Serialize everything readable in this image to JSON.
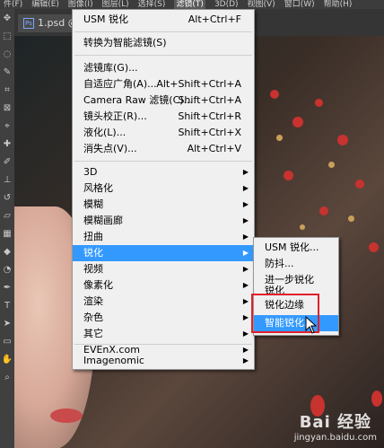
{
  "menubar": {
    "items": [
      "件(F)",
      "编辑(E)",
      "图像(I)",
      "图层(L)",
      "选择(S)",
      "滤镜(T)",
      "3D(D)",
      "视图(V)",
      "窗口(W)",
      "帮助(H)"
    ],
    "active": "滤镜(T)"
  },
  "tab": {
    "label": "1.psd @"
  },
  "filter_menu": {
    "last_filter": {
      "label": "USM 锐化",
      "shortcut": "Alt+Ctrl+F"
    },
    "convert_smart": {
      "label": "转换为智能滤镜(S)"
    },
    "group2": [
      {
        "label": "滤镜库(G)...",
        "shortcut": ""
      },
      {
        "label": "自适应广角(A)...",
        "shortcut": "Alt+Shift+Ctrl+A"
      },
      {
        "label": "Camera Raw 滤镜(C)...",
        "shortcut": "Shift+Ctrl+A"
      },
      {
        "label": "镜头校正(R)...",
        "shortcut": "Shift+Ctrl+R"
      },
      {
        "label": "液化(L)...",
        "shortcut": "Shift+Ctrl+X"
      },
      {
        "label": "消失点(V)...",
        "shortcut": "Alt+Ctrl+V"
      }
    ],
    "group3": [
      "3D",
      "风格化",
      "模糊",
      "模糊画廊",
      "扭曲",
      "锐化",
      "视频",
      "像素化",
      "渲染",
      "杂色",
      "其它"
    ],
    "highlighted": "锐化",
    "group4": [
      "EVEnX.com",
      "Imagenomic"
    ]
  },
  "sharpen_submenu": {
    "items": [
      "USM 锐化...",
      "防抖...",
      "进一步锐化",
      "锐化",
      "锐化边缘",
      "智能锐化..."
    ],
    "highlighted": "智能锐化..."
  },
  "watermark": {
    "main": "Bai 经验",
    "sub": "jingyan.baidu.com"
  },
  "colors": {
    "highlight": "#3399ff",
    "menu_bg": "#f0f0f0",
    "callout": "#e0202a"
  }
}
